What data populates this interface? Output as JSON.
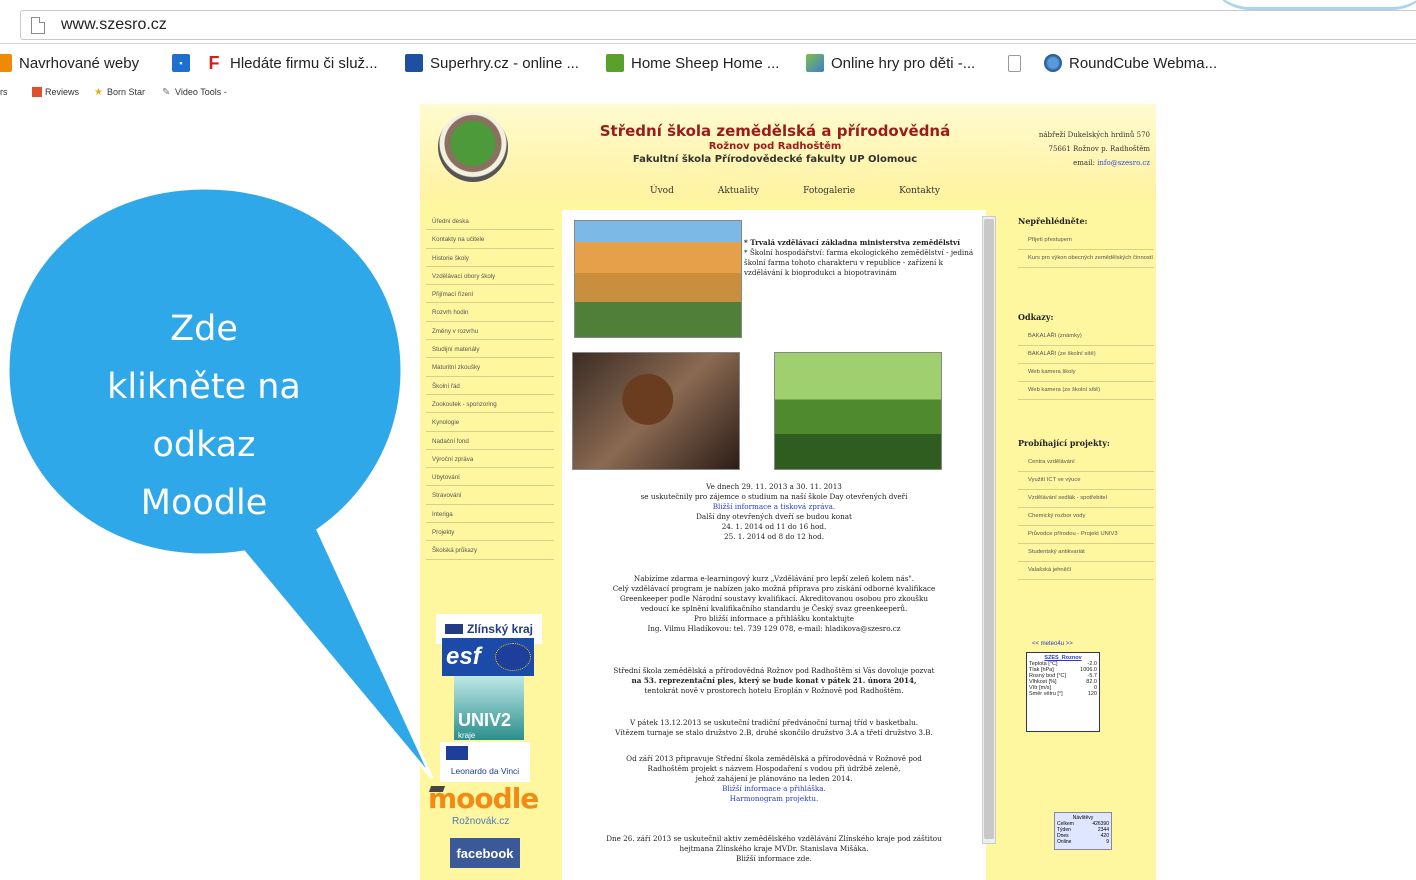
{
  "browser": {
    "url": "www.szesro.cz",
    "bookmarks": [
      {
        "label": "Navrhované weby",
        "icon": "orange-bookmark-icon",
        "color": "#f08a00"
      },
      {
        "label": "Hledáte firmu či služ...",
        "icon": "firmy-icon",
        "color": "#d51f1f"
      },
      {
        "label": "Superhry.cz - online ...",
        "icon": "superhry-icon",
        "color": "#1f4fa0"
      },
      {
        "label": "Home Sheep Home ...",
        "icon": "sheep-game-icon",
        "color": "#5aa02c"
      },
      {
        "label": "Online hry pro děti -...",
        "icon": "kids-games-icon",
        "color": "#6a9a3a"
      },
      {
        "label": "",
        "icon": "blank-page-icon",
        "color": "#999999"
      },
      {
        "label": "RoundCube Webma...",
        "icon": "roundcube-icon",
        "color": "#2a6fb0"
      }
    ],
    "toolbar2": [
      {
        "label": "rs"
      },
      {
        "label": "Reviews"
      },
      {
        "label": "Born Star"
      },
      {
        "label": "Video Tools -"
      }
    ]
  },
  "site": {
    "name": "Střední škola zemědělská a přírodovědná",
    "city": "Rožnov pod Radhoštěm",
    "faculty": "Fakultní škola Přírodovědecké fakulty UP Olomouc",
    "address_line1": "nábřeží Dukelských hrdinů 570",
    "address_line2": "75661 Rožnov p. Radhoštěm",
    "address_email_label": "email: ",
    "address_email": "info@szesro.cz",
    "topnav": [
      "Úvod",
      "Aktuality",
      "Fotogalerie",
      "Kontakty"
    ],
    "leftnav": [
      "Úřední deska",
      "Kontakty na učitele",
      "Historie školy",
      "Vzdělávací obory školy",
      "Přijímací řízení",
      "Rozvrh hodin",
      "Změny v rozvrhu",
      "Studijní materiály",
      "Maturitní zkoušky",
      "Školní řád",
      "Zookoutek - sponzoring",
      "Kynologie",
      "Nadační fond",
      "Výroční zpráva",
      "Ubytování",
      "Stravování",
      "Interiga",
      "Projekty",
      "Školská průkazy"
    ],
    "intro": [
      "* Trvalá vzdělávací základna ministerstva zemědělství",
      "* Školní hospodářství: farma ekologického zemědělství - jediná školní farma tohoto charakteru v republice - zařízení k vzdělávání k bioprodukci a biopotravinám"
    ],
    "news": {
      "open_days_1": "Ve dnech 29. 11. 2013 a 30. 11. 2013",
      "open_days_2": "se uskutečnily pro zájemce o studium na naší škole Day otevřených dveří",
      "open_days_3": "Bližší informace a tisková zpráva.",
      "open_days_4": "Další dny otevřených dveří se budou konat",
      "open_days_5": "24. 1. 2014 od 11 do 16 hod.",
      "open_days_6": "25. 1. 2014 od 8 do 12 hod.",
      "elearning_1": "Nabízíme zdarma e-learningový kurz „Vzdělávání pro lepší zeleň kolem nás\".",
      "elearning_2": "Celý vzdělávací program je nabízen jako možná příprava pro získání odborné kvalifikace",
      "elearning_3": "Greenkeeper podle Národní soustavy kvalifikací. Akreditovanou osobou pro zkoušku",
      "elearning_4": "vedoucí ke splnění kvalifikačního standardu je Český svaz greenkeeperů.",
      "elearning_5": "Pro bližší informace a přihlášku kontaktujte",
      "elearning_6": "Ing. Vilmu Hladíkovou: tel. 739 129 078, e-mail: hladikova@szesro.cz",
      "ples_1": "Střední škola zemědělská a přírodovědná Rožnov pod Radhoštěm si Vás dovoluje pozvat",
      "ples_2": "na 53. reprezentační ples, který se bude konat v pátek 21. února 2014,",
      "ples_3": "tentokrát nově v prostorech hotelu Eroplán v Rožnově pod Radhoštěm.",
      "basket_1": "V pátek 13.12.2013 se uskuteční tradiční předvánoční turnaj tříd v basketbalu.",
      "basket_2": "Vítězem turnaje se stalo družstvo 2.B, druhé skončilo družstvo 3.A a třetí družstvo 3.B.",
      "proj_1": "Od září 2013 připravuje Střední škola zemědělská a přírodovědná v Rožnově pod",
      "proj_2": "Radhoštěm projekt s názvem Hospodaření s vodou při údržbě zeleně,",
      "proj_3": "jehož zahájení je plánováno na leden 2014.",
      "proj_4": "Bližší informace a přihláška.",
      "proj_5": "Harmonogram projektu.",
      "aktiv_1": "Dne 26. září 2013 se uskutečnil aktiv zemědělského vzdělávání Zlínského kraje pod záštitou",
      "aktiv_2": "hejtmana Zlínského kraje MVDr. Stanislava Mišáka.",
      "aktiv_3": "Bližší informace zde."
    },
    "right": {
      "head1": "Nepřehlédněte:",
      "items1": [
        "Přijetí přestupem",
        "Kurs pro výkon obecných zemědělských činností"
      ],
      "head2": "Odkazy:",
      "items2": [
        "BAKALÁŘI (známky)",
        "BAKALÁŘI (ze školní sítě)",
        "Web kamera školy",
        "Web kamera (ze školní sítě)"
      ],
      "head3": "Probíhající projekty:",
      "items3": [
        "Centra vzdělávání",
        "Využití ICT ve výuce",
        "Vzdělávání sedlák - spotřebitel",
        "Chemický rozbor vody",
        "Průvodce přírodou - Projekt UNIV3",
        "Studentský antikvariát",
        "Valašská jehněčí"
      ]
    },
    "weather": {
      "head": "<< meteo4u >>",
      "title": "SZES_Roznov",
      "rows": [
        {
          "k": "Teplota [°C]",
          "v": "-2.0"
        },
        {
          "k": "Tlak [hPa]",
          "v": "1006.0"
        },
        {
          "k": "Rosný bod [°C]",
          "v": "-5.7"
        },
        {
          "k": "Vlhkost [%]",
          "v": "82.0"
        },
        {
          "k": "Vítr [m/s]",
          "v": "0"
        },
        {
          "k": "Směr větru [°]",
          "v": "120"
        }
      ]
    },
    "counter": {
      "title": "Návštěvy",
      "rows": [
        {
          "k": "Celkem",
          "v": "426390"
        },
        {
          "k": "Týden",
          "v": "2344"
        },
        {
          "k": "Dnes",
          "v": "420"
        },
        {
          "k": "Online",
          "v": "9"
        }
      ]
    },
    "banners": {
      "zlin": "Zlínský kraj",
      "esf": "esf",
      "univ": "UNIV2",
      "univ_sub": "kraje",
      "leonardo": "Leonardo da Vinci",
      "moodle": "moodle",
      "roznov": "Rožnovák.cz",
      "facebook": "facebook"
    }
  },
  "callout": {
    "lines": [
      "Zde",
      "klikněte na",
      "odkaz",
      "Moodle"
    ],
    "fill": "#2ea8e8",
    "stroke": "#ffffff"
  }
}
